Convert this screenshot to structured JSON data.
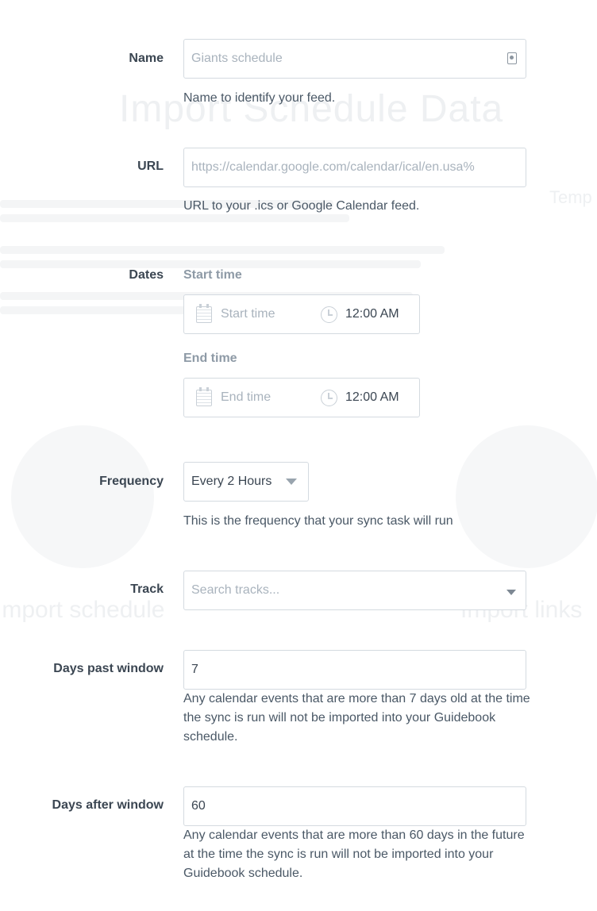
{
  "background": {
    "heading": "Import Schedule Data",
    "side_heading": "Temp",
    "card_left_title": "Import schedule",
    "card_right_title": "Import links"
  },
  "form": {
    "name": {
      "label": "Name",
      "placeholder": "Giants schedule",
      "help": "Name to identify your feed."
    },
    "url": {
      "label": "URL",
      "placeholder": "https://calendar.google.com/calendar/ical/en.usa%",
      "help": "URL to your .ics or Google Calendar feed."
    },
    "dates": {
      "label": "Dates",
      "start_label": "Start time",
      "start_placeholder": "Start time",
      "start_time": "12:00 AM",
      "end_label": "End time",
      "end_placeholder": "End time",
      "end_time": "12:00 AM"
    },
    "frequency": {
      "label": "Frequency",
      "value": "Every 2 Hours",
      "help": "This is the frequency that your sync task will run"
    },
    "track": {
      "label": "Track",
      "placeholder": "Search tracks..."
    },
    "days_past": {
      "label": "Days past window",
      "value": "7",
      "help": "Any calendar events that are more than 7 days old at the time the sync is run will not be imported into your Guidebook schedule."
    },
    "days_after": {
      "label": "Days after window",
      "value": "60",
      "help": "Any calendar events that are more than 60 days in the future at the time the sync is run will not be imported into your Guidebook schedule."
    }
  },
  "colors": {
    "label": "#3b4652",
    "placeholder": "#a9b3bd",
    "border": "#d4dae0"
  }
}
